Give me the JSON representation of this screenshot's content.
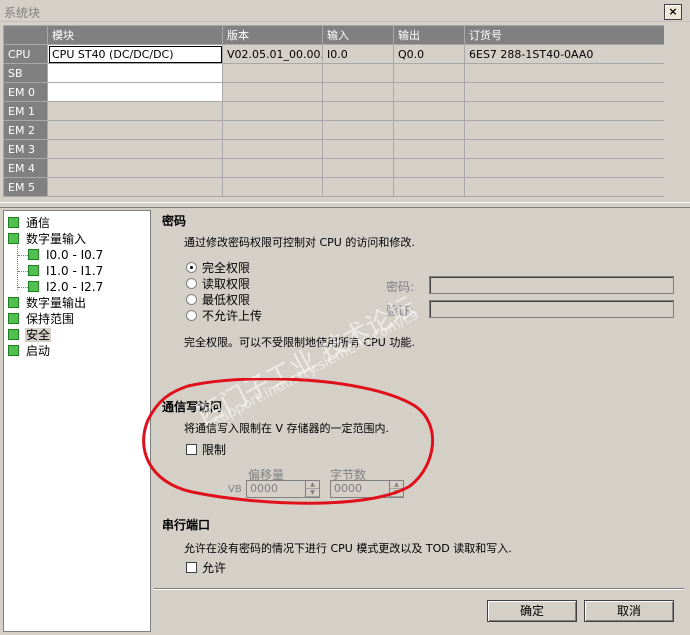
{
  "window": {
    "title": "系统块",
    "close_label": "×"
  },
  "grid": {
    "headers": [
      "",
      "模块",
      "版本",
      "输入",
      "输出",
      "订货号"
    ],
    "rows": [
      {
        "name": "CPU",
        "module": "CPU ST40 (DC/DC/DC)",
        "version": "V02.05.01_00.00...",
        "input": "I0.0",
        "output": "Q0.0",
        "order": "6ES7 288-1ST40-0AA0"
      },
      {
        "name": "SB",
        "module": "",
        "version": "",
        "input": "",
        "output": "",
        "order": ""
      },
      {
        "name": "EM 0",
        "module": "",
        "version": "",
        "input": "",
        "output": "",
        "order": ""
      },
      {
        "name": "EM 1",
        "module": "",
        "version": "",
        "input": "",
        "output": "",
        "order": ""
      },
      {
        "name": "EM 2",
        "module": "",
        "version": "",
        "input": "",
        "output": "",
        "order": ""
      },
      {
        "name": "EM 3",
        "module": "",
        "version": "",
        "input": "",
        "output": "",
        "order": ""
      },
      {
        "name": "EM 4",
        "module": "",
        "version": "",
        "input": "",
        "output": "",
        "order": ""
      },
      {
        "name": "EM 5",
        "module": "",
        "version": "",
        "input": "",
        "output": "",
        "order": ""
      }
    ]
  },
  "tree": {
    "items": [
      {
        "label": "通信"
      },
      {
        "label": "数字量输入"
      },
      {
        "label": "I0.0 - I0.7"
      },
      {
        "label": "I1.0 - I1.7"
      },
      {
        "label": "I2.0 - I2.7"
      },
      {
        "label": "数字量输出"
      },
      {
        "label": "保持范围"
      },
      {
        "label": "安全"
      },
      {
        "label": "启动"
      }
    ]
  },
  "password": {
    "title": "密码",
    "description": "通过修改密码权限可控制对 CPU 的访问和修改.",
    "options": [
      "完全权限",
      "读取权限",
      "最低权限",
      "不允许上传"
    ],
    "selected": "完全权限",
    "password_label": "密码:",
    "verify_label": "验证:",
    "note": "完全权限。可以不受限制地使用所有 CPU 功能."
  },
  "comm_write": {
    "title": "通信写访问",
    "description": "将通信写入限制在 V 存储器的一定范围内.",
    "restrict_label": "限制",
    "offset_label": "偏移量",
    "bytes_label": "字节数",
    "vb_label": "VB",
    "offset_value": "0000",
    "bytes_value": "0000"
  },
  "serial": {
    "title": "串行端口",
    "description": "允许在没有密码的情况下进行 CPU 模式更改以及 TOD 读取和写入.",
    "allow_label": "允许"
  },
  "buttons": {
    "ok": "确定",
    "cancel": "取消"
  },
  "watermark": {
    "text_cn": "西门子工业   技术论坛",
    "text_url": "support.industry.siemens.com/cs"
  },
  "colors": {
    "annotation": "#e0101a",
    "tree_box": "#50c050",
    "header": "#808080"
  }
}
